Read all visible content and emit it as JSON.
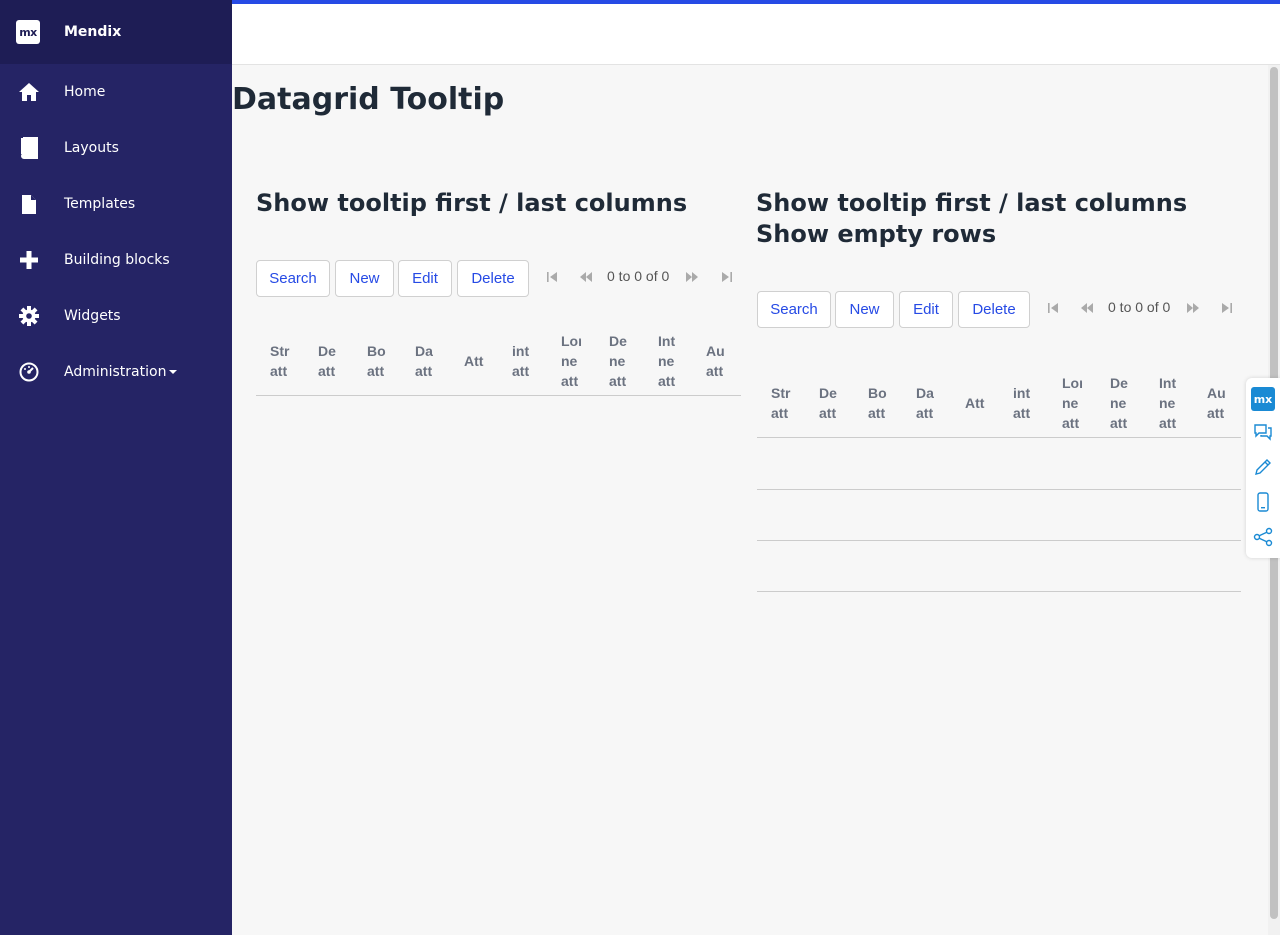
{
  "app": {
    "brand_logo": "mx",
    "brand_name": "Mendix"
  },
  "sidebar": {
    "items": [
      {
        "label": "Home",
        "icon": "home-icon"
      },
      {
        "label": "Layouts",
        "icon": "book-icon"
      },
      {
        "label": "Templates",
        "icon": "file-icon"
      },
      {
        "label": "Building blocks",
        "icon": "plus-icon"
      },
      {
        "label": "Widgets",
        "icon": "gear-icon"
      },
      {
        "label": "Administration",
        "icon": "dashboard-icon"
      }
    ]
  },
  "page": {
    "title": "Datagrid Tooltip"
  },
  "grids": [
    {
      "title_line1": "Show tooltip first / last columns",
      "title_line2": "",
      "buttons": [
        "Search",
        "New",
        "Edit",
        "Delete"
      ],
      "pager_text": "0 to 0 of 0",
      "columns": [
        "Str\natt",
        "De\natt",
        "Bo\natt",
        "Da\natt",
        "Att",
        "int\natt",
        "Lor\nne\natt",
        "De\nne\natt",
        "Int\nne\natt",
        "Au\natt"
      ]
    },
    {
      "title_line1": "Show tooltip first / last columns",
      "title_line2": "Show empty rows",
      "buttons": [
        "Search",
        "New",
        "Edit",
        "Delete"
      ],
      "pager_text": "0 to 0 of 0",
      "columns": [
        "Str\natt",
        "De\natt",
        "Bo\natt",
        "Da\natt",
        "Att",
        "int\natt",
        "Lor\nne\natt",
        "De\nne\natt",
        "Int\nne\natt",
        "Au\natt"
      ]
    }
  ],
  "side_toolbar": {
    "logo": "mx",
    "icons": [
      "chat-icon",
      "pencil-icon",
      "mobile-icon",
      "share-icon"
    ]
  },
  "colors": {
    "sidebar_bg": "#252465",
    "brand_bg": "#1e1d55",
    "accent": "#264ae5",
    "toolbar_accent": "#1a8ad4"
  }
}
